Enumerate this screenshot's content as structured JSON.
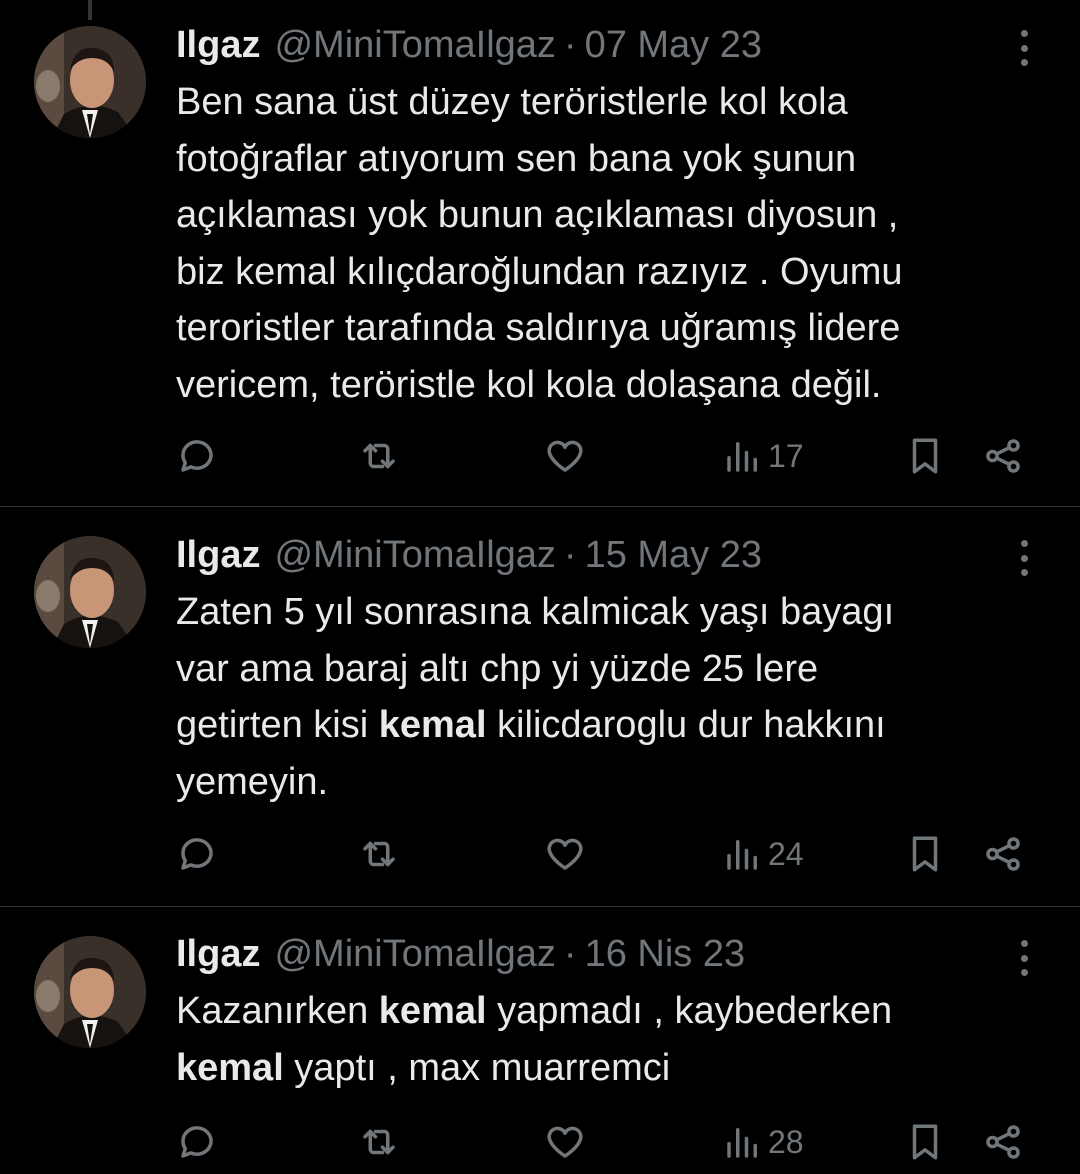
{
  "tweets": [
    {
      "name": "Ilgaz",
      "handle": "@MiniTomaIlgaz",
      "separator": "·",
      "date": "07 May 23",
      "lines": [
        [
          {
            "t": "Ben sana üst düzey teröristlerle kol kola"
          }
        ],
        [
          {
            "t": "fotoğraflar atıyorum sen bana yok şunun"
          }
        ],
        [
          {
            "t": "açıklaması yok bunun açıklaması diyosun ,"
          }
        ],
        [
          {
            "t": "biz kemal kılıçdaroğlundan razıyız . Oyumu"
          }
        ],
        [
          {
            "t": "teroristler tarafında saldırıya uğramış lidere"
          }
        ],
        [
          {
            "t": "vericem, teröristle kol kola dolaşana değil."
          }
        ]
      ],
      "views": "17"
    },
    {
      "name": "Ilgaz",
      "handle": "@MiniTomaIlgaz",
      "separator": "·",
      "date": "15 May 23",
      "lines": [
        [
          {
            "t": "Zaten 5 yıl sonrasına kalmicak yaşı bayagı"
          }
        ],
        [
          {
            "t": "var ama baraj altı chp yi yüzde 25 lere"
          }
        ],
        [
          {
            "t": "getirten kisi "
          },
          {
            "t": "kemal",
            "b": true
          },
          {
            "t": " kilicdaroglu dur hakkını"
          }
        ],
        [
          {
            "t": "yemeyin."
          }
        ]
      ],
      "views": "24"
    },
    {
      "name": "Ilgaz",
      "handle": "@MiniTomaIlgaz",
      "separator": "·",
      "date": "16 Nis 23",
      "lines": [
        [
          {
            "t": "Kazanırken "
          },
          {
            "t": "kemal",
            "b": true
          },
          {
            "t": " yapmadı , kaybederken"
          }
        ],
        [
          {
            "t": "kemal",
            "b": true
          },
          {
            "t": " yaptı , max muarremci"
          }
        ]
      ],
      "views": "28"
    }
  ],
  "icons": {
    "reply": "reply-icon",
    "repost": "repost-icon",
    "like": "heart-icon",
    "views": "views-chart-icon",
    "bookmark": "bookmark-icon",
    "share": "share-icon",
    "more": "more-dots-icon"
  },
  "colors": {
    "background": "#000000",
    "text": "#e7e9ea",
    "muted": "#71767b",
    "divider": "#2f3336"
  }
}
